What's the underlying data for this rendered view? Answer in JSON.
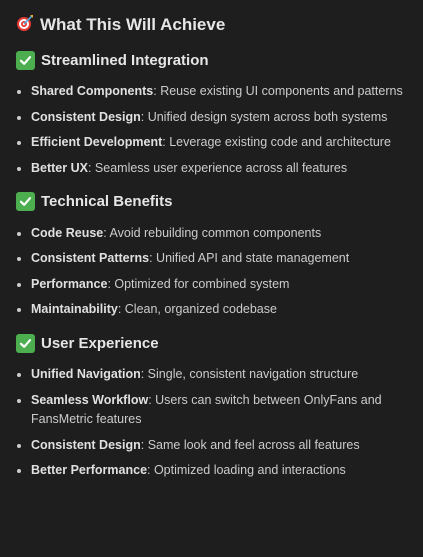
{
  "title": {
    "icon": "target-icon",
    "text": "What This Will Achieve"
  },
  "colors": {
    "background": "#1e1e1e",
    "text": "#cccccc",
    "check_green": "#4cae4f"
  },
  "sections": [
    {
      "icon": "check-mark-icon",
      "heading": "Streamlined Integration",
      "items": [
        {
          "term": "Shared Components",
          "desc": ": Reuse existing UI components and patterns"
        },
        {
          "term": "Consistent Design",
          "desc": ": Unified design system across both systems"
        },
        {
          "term": "Efficient Development",
          "desc": ": Leverage existing code and architecture"
        },
        {
          "term": "Better UX",
          "desc": ": Seamless user experience across all features"
        }
      ]
    },
    {
      "icon": "check-mark-icon",
      "heading": "Technical Benefits",
      "items": [
        {
          "term": "Code Reuse",
          "desc": ": Avoid rebuilding common components"
        },
        {
          "term": "Consistent Patterns",
          "desc": ": Unified API and state management"
        },
        {
          "term": "Performance",
          "desc": ": Optimized for combined system"
        },
        {
          "term": "Maintainability",
          "desc": ": Clean, organized codebase"
        }
      ]
    },
    {
      "icon": "check-mark-icon",
      "heading": "User Experience",
      "items": [
        {
          "term": "Unified Navigation",
          "desc": ": Single, consistent navigation structure"
        },
        {
          "term": "Seamless Workflow",
          "desc": ": Users can switch between OnlyFans and FansMetric features"
        },
        {
          "term": "Consistent Design",
          "desc": ": Same look and feel across all features"
        },
        {
          "term": "Better Performance",
          "desc": ": Optimized loading and interactions"
        }
      ]
    }
  ]
}
